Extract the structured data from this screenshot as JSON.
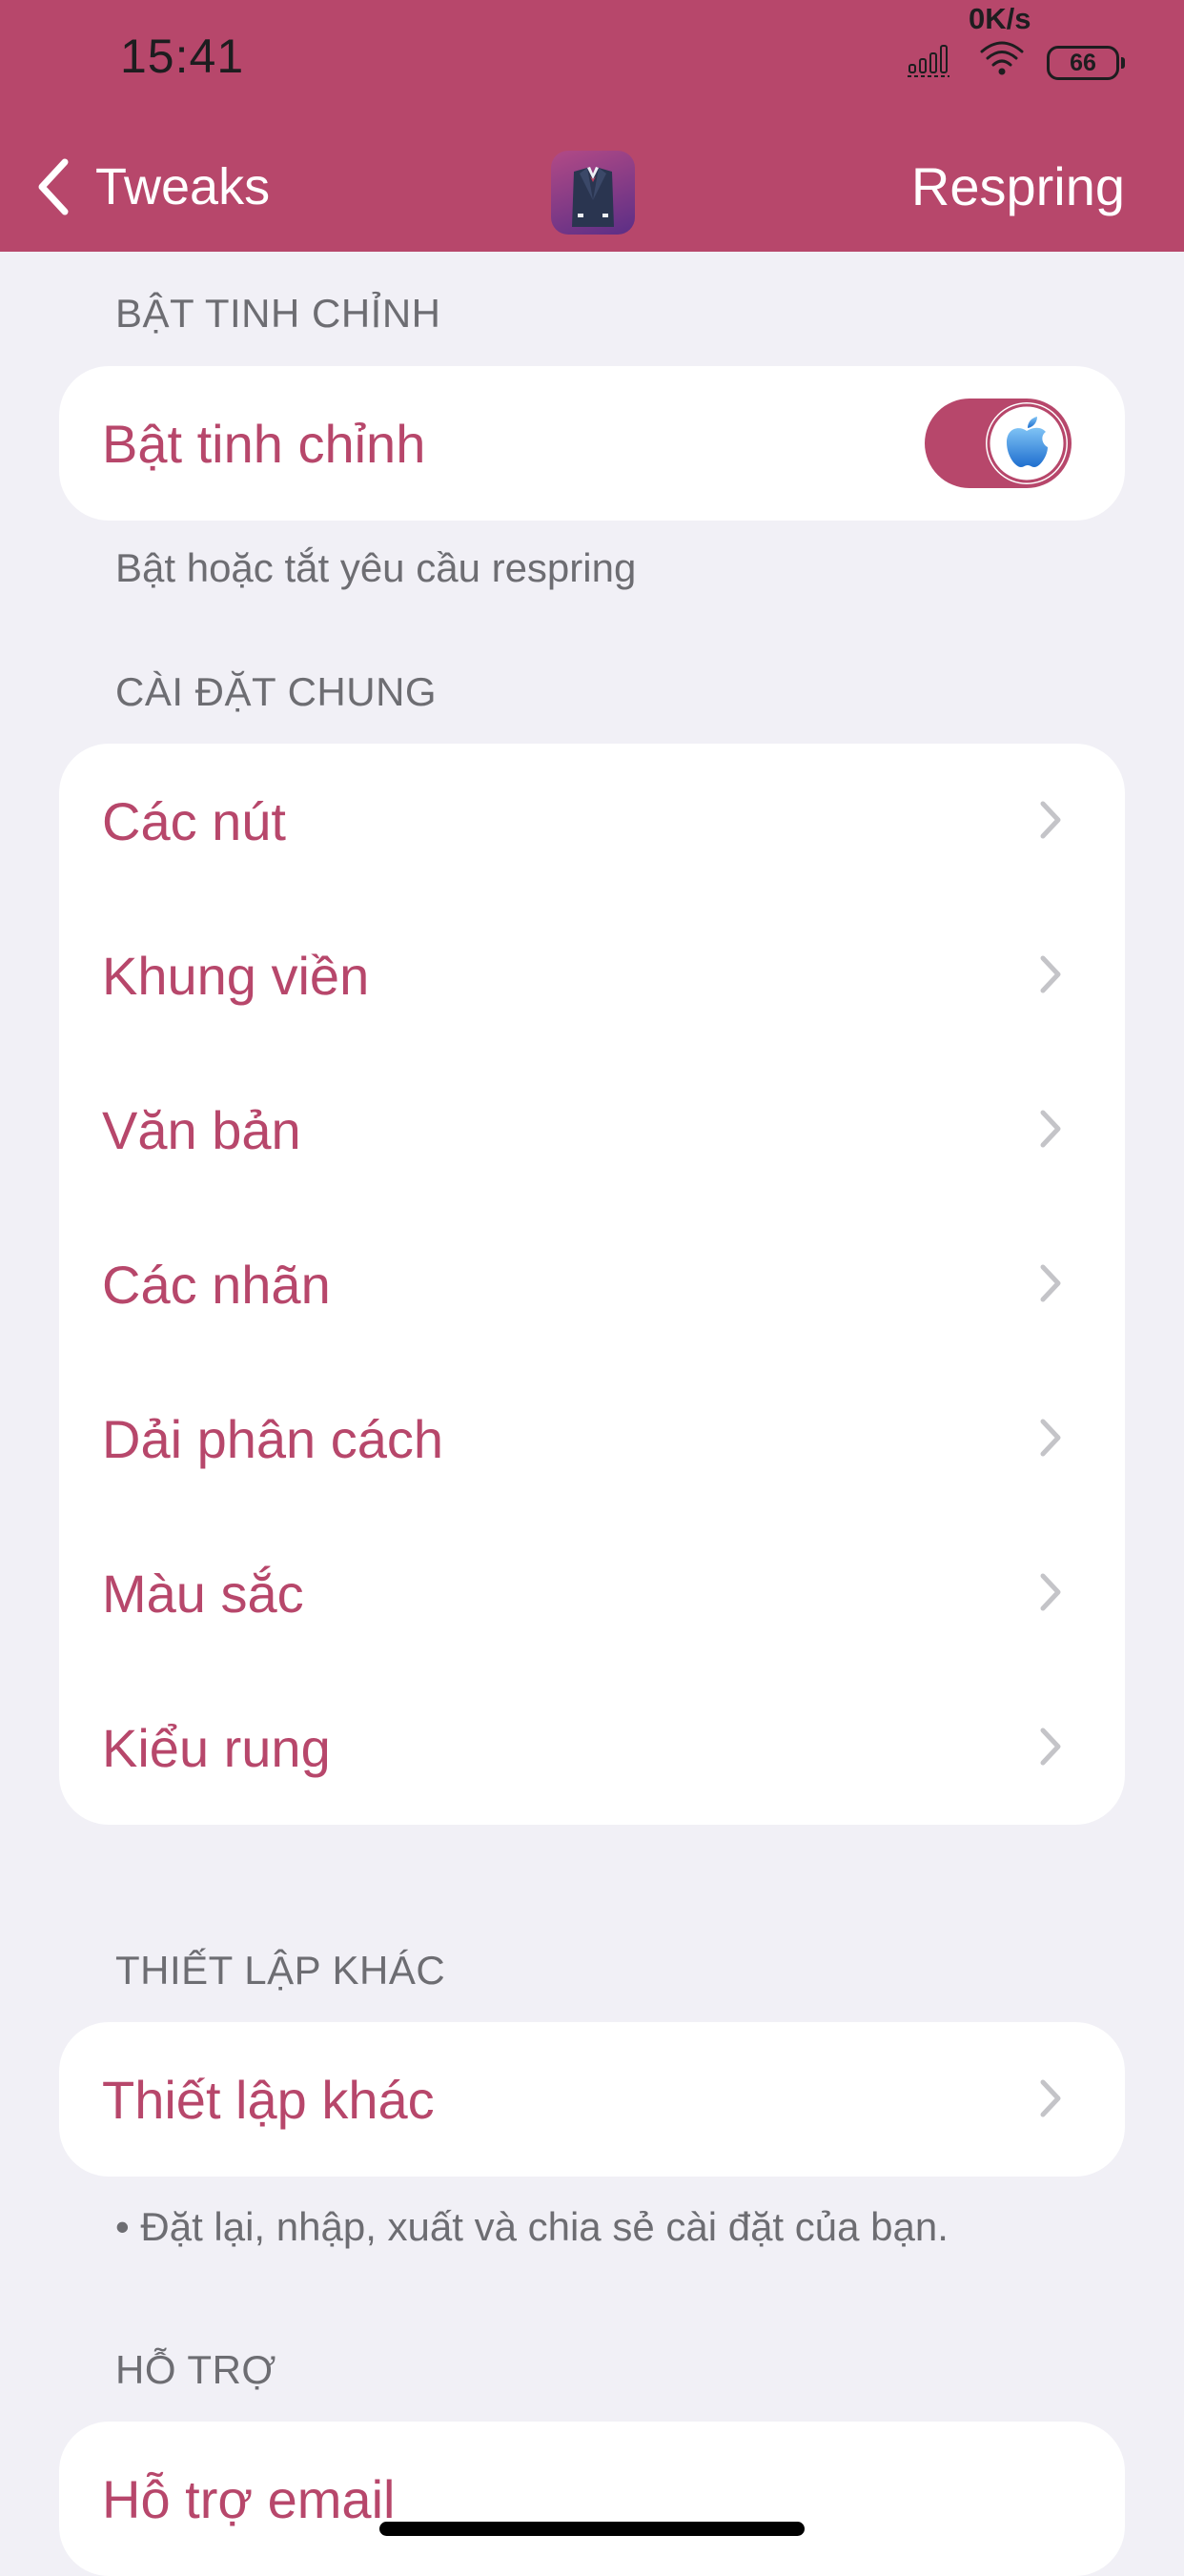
{
  "status_bar": {
    "time": "15:41",
    "net_speed": "0K/s",
    "battery": "66"
  },
  "nav": {
    "back_label": "Tweaks",
    "action_label": "Respring",
    "app_icon": "suit-tuxedo-icon"
  },
  "sections": {
    "enable": {
      "header": "BẬT TINH CHỈNH",
      "toggle_label": "Bật tinh chỉnh",
      "toggle_on": true,
      "footer": "Bật hoặc tắt yêu cầu respring"
    },
    "general": {
      "header": "CÀI ĐẶT CHUNG",
      "items": [
        {
          "label": "Các nút"
        },
        {
          "label": "Khung viền"
        },
        {
          "label": "Văn bản"
        },
        {
          "label": "Các nhãn"
        },
        {
          "label": "Dải phân cách"
        },
        {
          "label": "Màu sắc"
        },
        {
          "label": "Kiểu rung"
        }
      ]
    },
    "other": {
      "header": "THIẾT LẬP KHÁC",
      "item_label": "Thiết lập khác",
      "footer": "• Đặt lại, nhập, xuất và chia sẻ cài đặt của bạn."
    },
    "support": {
      "header": "HỖ TRỢ",
      "item_label": "Hỗ trợ email"
    }
  },
  "colors": {
    "accent": "#b7476b",
    "background": "#f1f0f6",
    "section_text": "#6d6d72"
  }
}
